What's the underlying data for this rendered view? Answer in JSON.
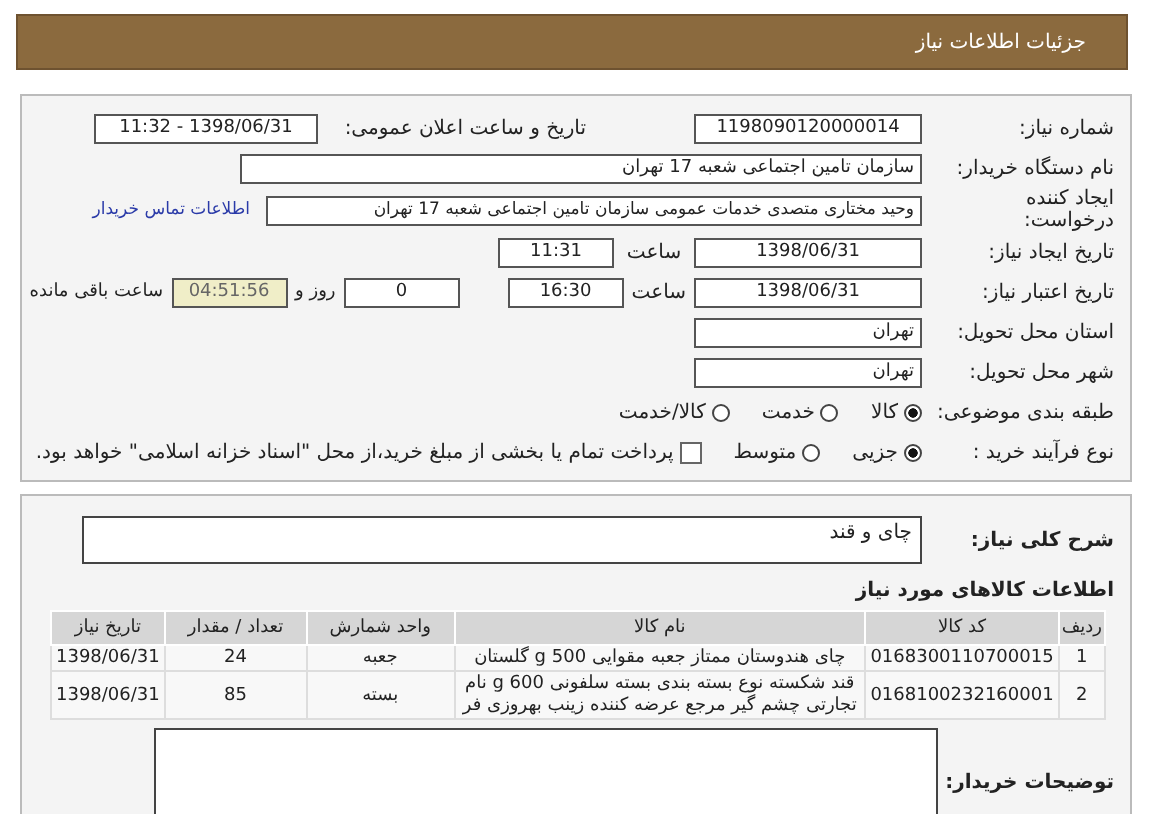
{
  "header": {
    "title": "جزئیات اطلاعات نیاز"
  },
  "details": {
    "need_number": {
      "label": "شماره نیاز:",
      "value": "1198090120000014"
    },
    "announce": {
      "label": "تاریخ و ساعت اعلان عمومی:",
      "value": "1398/06/31 - 11:32"
    },
    "buyer_org": {
      "label": "نام دستگاه خریدار:",
      "value": "سازمان تامین اجتماعی شعبه 17 تهران"
    },
    "requester": {
      "label": "ایجاد کننده درخواست:",
      "value": "وحید  مختاری  متصدی خدمات عمومی  سازمان تامین اجتماعی شعبه 17 تهران",
      "link": "اطلاعات تماس خریدار"
    },
    "created": {
      "label": "تاریخ ایجاد نیاز:",
      "date": "1398/06/31",
      "time_label": "ساعت",
      "time": "11:31"
    },
    "deadline": {
      "label": "تاریخ اعتبار نیاز:",
      "date": "1398/06/31",
      "time_label": "ساعت",
      "time": "16:30",
      "days": "0",
      "days_label": "روز و",
      "remaining": "04:51:56",
      "remaining_label": "ساعت باقی مانده"
    },
    "province": {
      "label": "استان محل تحویل:",
      "value": "تهران"
    },
    "city": {
      "label": "شهر محل تحویل:",
      "value": "تهران"
    },
    "category": {
      "label": "طبقه بندی موضوعی:",
      "options": [
        {
          "label": "کالا",
          "selected": true
        },
        {
          "label": "خدمت",
          "selected": false
        },
        {
          "label": "کالا/خدمت",
          "selected": false
        }
      ]
    },
    "process": {
      "label": "نوع فرآیند خرید :",
      "options": [
        {
          "label": "جزیی",
          "selected": true
        },
        {
          "label": "متوسط",
          "selected": false
        }
      ],
      "payment": {
        "label": "پرداخت تمام یا بخشی از مبلغ خرید،از محل \"اسناد خزانه اسلامی\" خواهد بود.",
        "checked": false
      }
    }
  },
  "description": {
    "label": "شرح کلی نیاز:",
    "value": "چای و قند"
  },
  "goods": {
    "title": "اطلاعات کالاهای مورد نیاز",
    "columns": [
      "ردیف",
      "کد کالا",
      "نام کالا",
      "واحد شمارش",
      "تعداد / مقدار",
      "تاریخ نیاز"
    ],
    "rows": [
      [
        "1",
        "0168300110700015",
        "چای هندوستان ممتاز جعبه مقوایی 500 g گلستان",
        "جعبه",
        "24",
        "1398/06/31"
      ],
      [
        "2",
        "0168100232160001",
        "قند شکسته نوع بسته بندی بسته سلفونی 600 g نام تجارتی چشم گیر مرجع عرضه کننده زینب بهروزی فر",
        "بسته",
        "85",
        "1398/06/31"
      ]
    ]
  },
  "buyer_notes": {
    "label": "توضیحات خریدار:"
  }
}
